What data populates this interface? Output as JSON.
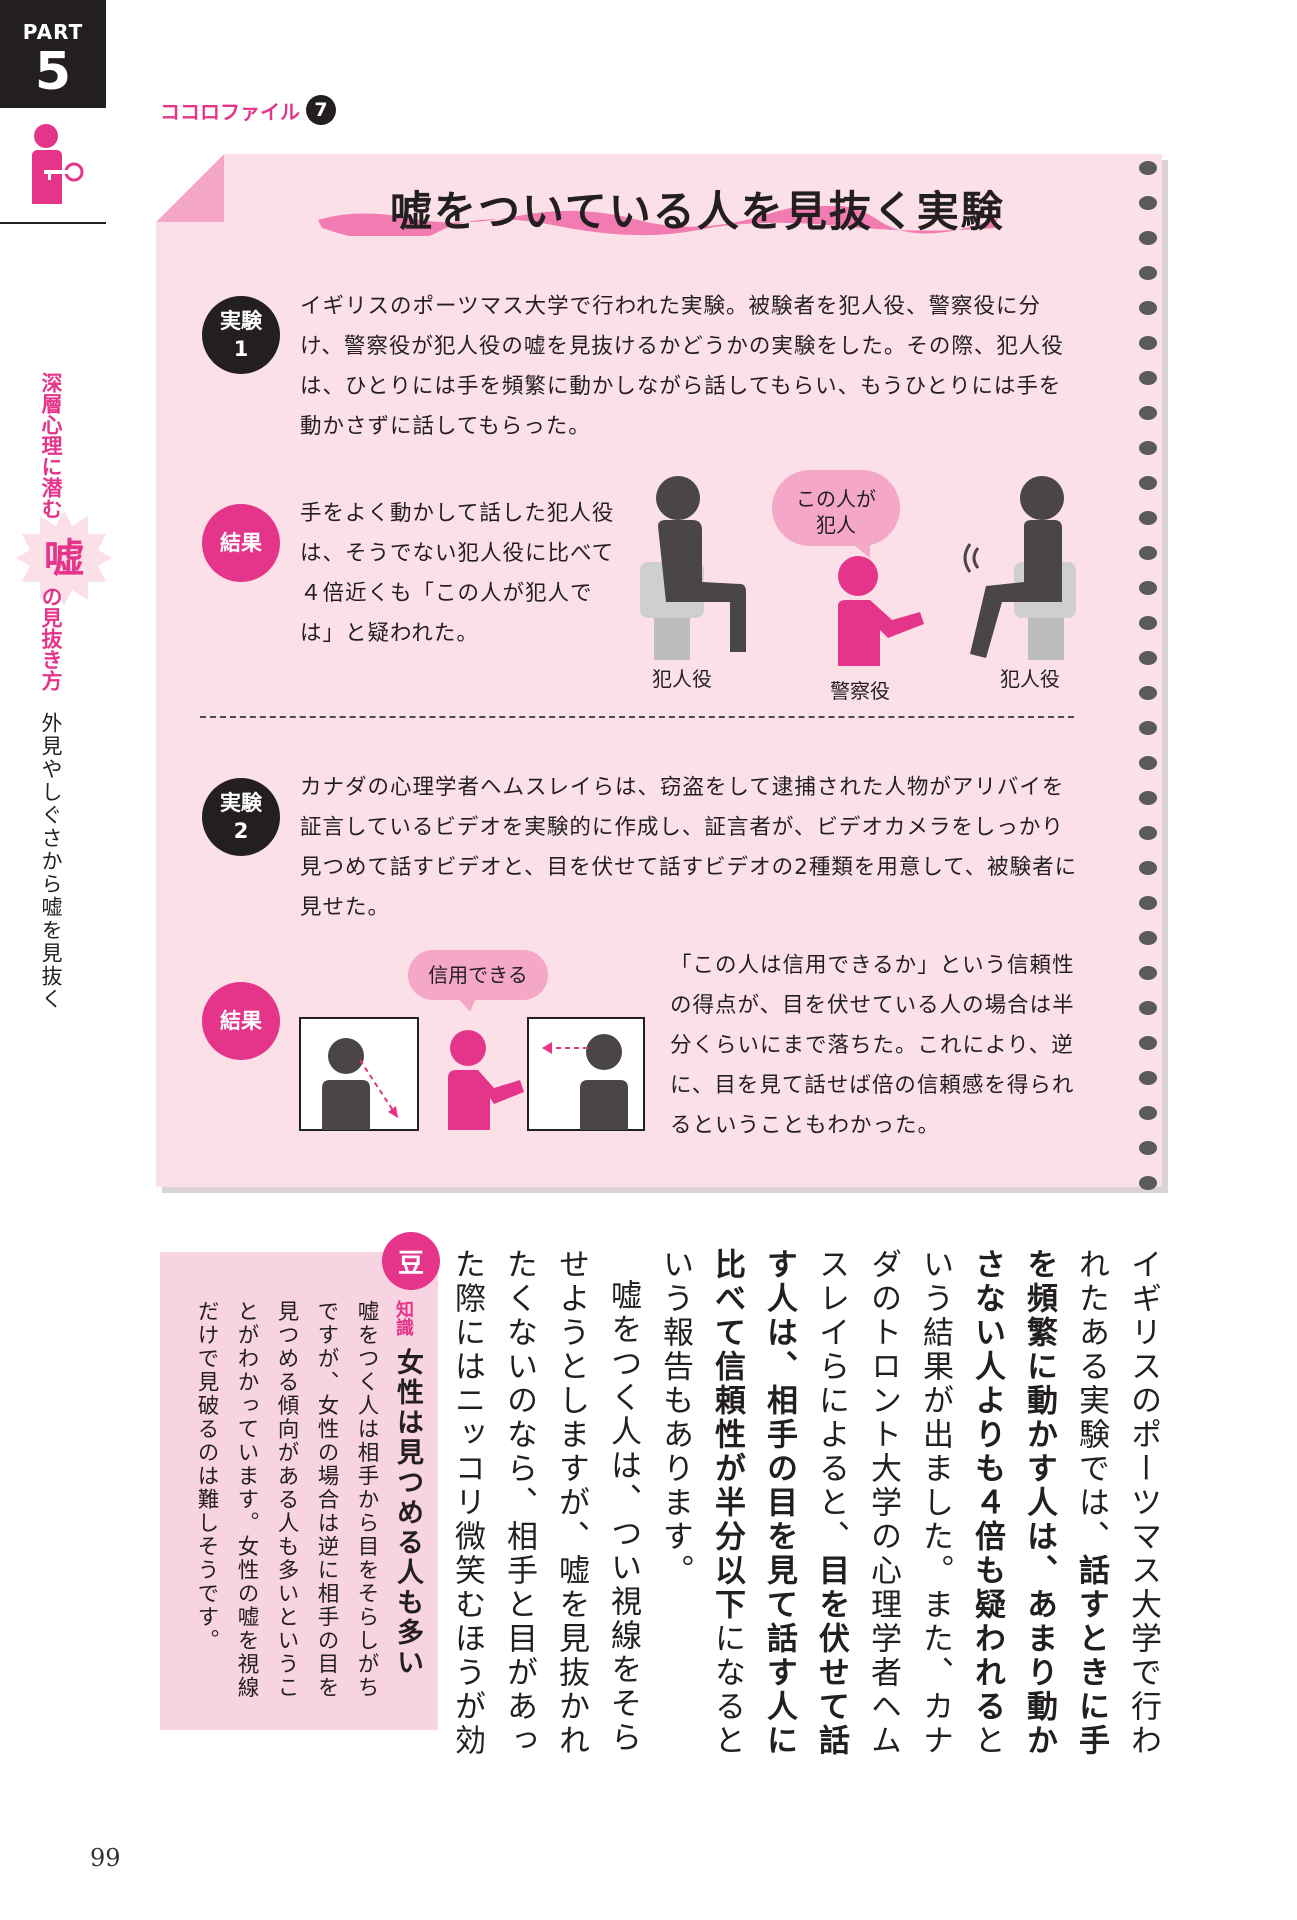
{
  "part": {
    "label": "PART",
    "number": "5"
  },
  "sidebar": {
    "title_a": "深層心理に潜む",
    "title_lie": "嘘",
    "title_b": "の見抜き方",
    "subtitle": "外見やしぐさから嘘を見抜く"
  },
  "file": {
    "label": "ココロファイル",
    "number": "7"
  },
  "card": {
    "title": "嘘をついている人を見抜く実験",
    "exp1": {
      "badge": [
        "実験",
        "1"
      ],
      "text": "イギリスのポーツマス大学で行われた実験。被験者を犯人役、警察役に分け、警察役が犯人役の嘘を見抜けるかどうかの実験をした。その際、犯人役は、ひとりには手を頻繁に動かしながら話してもらい、もうひとりには手を動かさずに話してもらった。"
    },
    "res1": {
      "badge": "結果",
      "text": "手をよく動かして話した犯人役は、そうでない犯人役に比べて４倍近くも「この人が犯人では」と疑われた。"
    },
    "illus1": {
      "bubble_line1": "この人が",
      "bubble_line2": "犯人",
      "label_left": "犯人役",
      "label_center": "警察役",
      "label_right": "犯人役"
    },
    "exp2": {
      "badge": [
        "実験",
        "2"
      ],
      "text": "カナダの心理学者ヘムスレイらは、窃盗をして逮捕された人物がアリバイを証言しているビデオを実験的に作成し、証言者が、ビデオカメラをしっかり見つめて話すビデオと、目を伏せて話すビデオの2種類を用意して、被験者に見せた。"
    },
    "res2": {
      "badge": "結果",
      "text": "「この人は信用できるか」という信頼性の得点が、目を伏せている人の場合は半分くらいにまで落ちた。これにより、逆に、目を見て話せば倍の信頼感を得られるということもわかった。"
    },
    "illus2": {
      "bubble": "信用できる"
    }
  },
  "body": {
    "p1_a": "イギリスのポーツマス大学で行われたある実験では、",
    "p1_b": "話すときに手を頻繁に動かす人は、あまり動かさない人よりも４倍も疑われる",
    "p1_c": "という結果が出ました。また、カナダのトロント大学の心理学者ヘムスレイらによると、",
    "p1_d": "目を伏せて話す人は、相手の目を見て話す人に比べて信頼性が半分以下",
    "p1_e": "になるという報告もあります。",
    "p2": "嘘をつく人は、つい視線をそらせようとしますが、嘘を見抜かれたくないのなら、相手と目があった際にはニッコリ微笑むほうが効果的だということです。"
  },
  "bean": {
    "icon": "豆",
    "small_label": "知識",
    "heading": "女性は見つめる人も多い",
    "text": "嘘をつく人は相手から目をそらしがちですが、女性の場合は逆に相手の目を見つめる傾向がある人も多いということがわかっています。女性の嘘を視線だけで見破るのは難しそうです。"
  },
  "page_number": "99",
  "colors": {
    "accent": "#e4358a",
    "card": "#fbe0e8",
    "dark": "#231f20",
    "bean_box": "#f8d3e2"
  }
}
